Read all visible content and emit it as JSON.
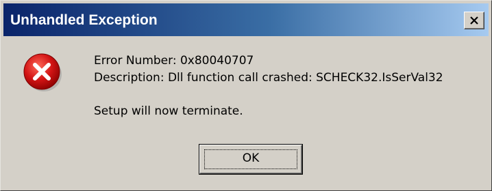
{
  "window": {
    "title": "Unhandled Exception",
    "close_icon": "close-icon"
  },
  "message": {
    "icon": "error-icon",
    "error_number": "Error Number: 0x80040707",
    "description": "Description: Dll function call crashed: SCHECK32.IsSerVal32",
    "note": "Setup will now terminate."
  },
  "buttons": {
    "ok_label": "OK"
  },
  "colors": {
    "titlebar_start": "#0a246a",
    "titlebar_end": "#a6caf0",
    "dialog_face": "#d4d0c8",
    "error_red": "#d21414"
  }
}
